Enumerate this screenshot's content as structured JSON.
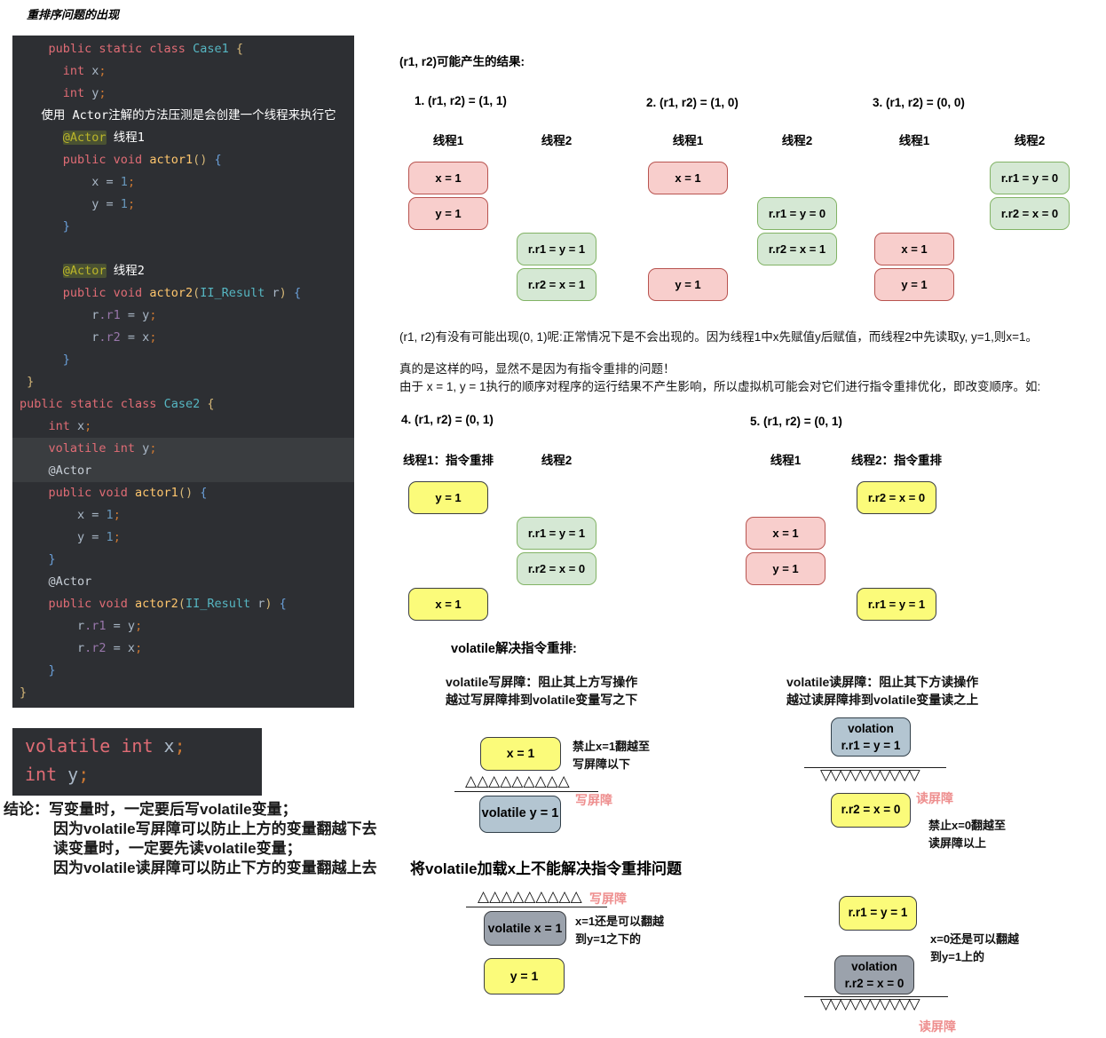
{
  "title": "重排序问题的出现",
  "colors": {
    "code_bg": "#2d2f33",
    "pink_fill": "#f8cecc",
    "pink_border": "#b85450",
    "green_fill": "#d5e8d4",
    "green_border": "#82b366",
    "yellow_fill": "#fbfb7a",
    "dark_border": "#3b3e42",
    "bluegray_fill": "#b3c5d1",
    "gray_fill": "#9ba2ac",
    "barrier_label": "#ee8f8f"
  },
  "code": {
    "main": {
      "lines": [
        {
          "t": [
            [
              "kw",
              "    public static class "
            ],
            [
              "cls",
              "Case1"
            ],
            [
              "by",
              " {"
            ]
          ]
        },
        {
          "t": [
            [
              "kw",
              "      int"
            ],
            [
              "pln",
              " x"
            ],
            [
              "semi",
              ";"
            ]
          ]
        },
        {
          "t": [
            [
              "kw",
              "      int"
            ],
            [
              "pln",
              " y"
            ],
            [
              "semi",
              ";"
            ]
          ]
        },
        {
          "t": [
            [
              "wht",
              "   使用 Actor注解的方法压测是会创建一个线程来执行它"
            ]
          ]
        },
        {
          "t": [
            [
              "pln",
              "      "
            ],
            [
              "ann1",
              "@Actor"
            ],
            [
              "wht",
              " 线程1"
            ]
          ]
        },
        {
          "t": [
            [
              "kw",
              "      public void "
            ],
            [
              "meth",
              "actor1"
            ],
            [
              "by",
              "()"
            ],
            [
              "pln",
              " "
            ],
            [
              "bb",
              "{"
            ]
          ]
        },
        {
          "t": [
            [
              "pln",
              "          x = "
            ],
            [
              "num",
              "1"
            ],
            [
              "semi",
              ";"
            ]
          ]
        },
        {
          "t": [
            [
              "pln",
              "          y = "
            ],
            [
              "num",
              "1"
            ],
            [
              "semi",
              ";"
            ]
          ]
        },
        {
          "t": [
            [
              "bb",
              "      }"
            ]
          ]
        },
        {
          "t": []
        },
        {
          "t": [
            [
              "pln",
              "      "
            ],
            [
              "ann1",
              "@Actor"
            ],
            [
              "wht",
              " 线程2"
            ]
          ]
        },
        {
          "t": [
            [
              "kw",
              "      public void "
            ],
            [
              "meth",
              "actor2"
            ],
            [
              "by",
              "("
            ],
            [
              "cls",
              "II_Result"
            ],
            [
              "pln",
              " r"
            ],
            [
              "by",
              ")"
            ],
            [
              "pln",
              " "
            ],
            [
              "bb",
              "{"
            ]
          ]
        },
        {
          "t": [
            [
              "pln",
              "          r"
            ],
            [
              "fld",
              ".r1"
            ],
            [
              "pln",
              " = y"
            ],
            [
              "semi",
              ";"
            ]
          ]
        },
        {
          "t": [
            [
              "pln",
              "          r"
            ],
            [
              "fld",
              ".r2"
            ],
            [
              "pln",
              " = x"
            ],
            [
              "semi",
              ";"
            ]
          ]
        },
        {
          "t": [
            [
              "bb",
              "      }"
            ]
          ]
        },
        {
          "t": [
            [
              "by",
              " }"
            ]
          ]
        },
        {
          "t": [
            [
              "kw",
              "public static class "
            ],
            [
              "cls",
              "Case2"
            ],
            [
              "by",
              " {"
            ]
          ]
        },
        {
          "t": [
            [
              "kw",
              "    int"
            ],
            [
              "pln",
              " x"
            ],
            [
              "semi",
              ";"
            ]
          ]
        },
        {
          "h": 1,
          "t": [
            [
              "kw",
              "    volatile int"
            ],
            [
              "pln",
              " y"
            ],
            [
              "semi",
              ";"
            ]
          ]
        },
        {
          "h": 1,
          "t": [
            [
              "ann2",
              "    @Actor"
            ]
          ]
        },
        {
          "t": [
            [
              "kw",
              "    public void "
            ],
            [
              "meth",
              "actor1"
            ],
            [
              "by",
              "()"
            ],
            [
              "pln",
              " "
            ],
            [
              "bb",
              "{"
            ]
          ]
        },
        {
          "t": [
            [
              "pln",
              "        x = "
            ],
            [
              "num",
              "1"
            ],
            [
              "semi",
              ";"
            ]
          ]
        },
        {
          "t": [
            [
              "pln",
              "        y = "
            ],
            [
              "num",
              "1"
            ],
            [
              "semi",
              ";"
            ]
          ]
        },
        {
          "t": [
            [
              "bb",
              "    }"
            ]
          ]
        },
        {
          "t": [
            [
              "ann2",
              "    @Actor"
            ]
          ]
        },
        {
          "t": [
            [
              "kw",
              "    public void "
            ],
            [
              "meth",
              "actor2"
            ],
            [
              "by",
              "("
            ],
            [
              "cls",
              "II_Result"
            ],
            [
              "pln",
              " r"
            ],
            [
              "by",
              ")"
            ],
            [
              "pln",
              " "
            ],
            [
              "bb",
              "{"
            ]
          ]
        },
        {
          "t": [
            [
              "pln",
              "        r"
            ],
            [
              "fld",
              ".r1"
            ],
            [
              "pln",
              " = y"
            ],
            [
              "semi",
              ";"
            ]
          ]
        },
        {
          "t": [
            [
              "pln",
              "        r"
            ],
            [
              "fld",
              ".r2"
            ],
            [
              "pln",
              " = x"
            ],
            [
              "semi",
              ";"
            ]
          ]
        },
        {
          "t": [
            [
              "bb",
              "    }"
            ]
          ]
        },
        {
          "t": [
            [
              "by",
              "}"
            ]
          ]
        }
      ]
    },
    "snippet": {
      "lines": [
        {
          "t": [
            [
              "kw",
              "volatile int"
            ],
            [
              "pln",
              " x"
            ],
            [
              "semi",
              ";"
            ]
          ]
        },
        {
          "t": [
            [
              "kw",
              "int"
            ],
            [
              "pln",
              " y"
            ],
            [
              "semi",
              ";"
            ]
          ]
        }
      ]
    }
  },
  "results": {
    "header": "(r1, r2)可能产生的结果:",
    "scenario_headers": [
      "1. (r1, r2) = (1, 1)",
      "2. (r1, r2) = (1, 0)",
      "3. (r1, r2) = (0, 0)",
      "4. (r1, r2) = (0, 1)",
      "5. (r1, r2) = (0, 1)"
    ],
    "scenarios": [
      {
        "col_labels": [
          "线程1",
          "线程2"
        ],
        "boxes": [
          {
            "col": 0,
            "row": 0,
            "color": "pink",
            "label": "x = 1"
          },
          {
            "col": 0,
            "row": 1,
            "color": "pink",
            "label": "y = 1"
          },
          {
            "col": 1,
            "row": 2,
            "color": "green",
            "label": "r.r1 = y = 1"
          },
          {
            "col": 1,
            "row": 3,
            "color": "green",
            "label": "r.r2 = x = 1"
          }
        ]
      },
      {
        "col_labels": [
          "线程1",
          "线程2"
        ],
        "boxes": [
          {
            "col": 0,
            "row": 0,
            "color": "pink",
            "label": "x = 1"
          },
          {
            "col": 1,
            "row": 1,
            "color": "green",
            "label": "r.r1 = y = 0"
          },
          {
            "col": 1,
            "row": 2,
            "color": "green",
            "label": "r.r2 = x = 1"
          },
          {
            "col": 0,
            "row": 3,
            "color": "pink",
            "label": "y = 1"
          }
        ]
      },
      {
        "col_labels": [
          "线程1",
          "线程2"
        ],
        "boxes": [
          {
            "col": 1,
            "row": 0,
            "color": "green",
            "label": "r.r1 = y = 0"
          },
          {
            "col": 1,
            "row": 1,
            "color": "green",
            "label": "r.r2 = x = 0"
          },
          {
            "col": 0,
            "row": 2,
            "color": "pink",
            "label": "x = 1"
          },
          {
            "col": 0,
            "row": 3,
            "color": "pink",
            "label": "y = 1"
          }
        ]
      },
      {
        "col_labels": [
          "线程1：指令重排",
          "线程2"
        ],
        "boxes": [
          {
            "col": 0,
            "row": 0,
            "color": "yellow",
            "label": "y = 1"
          },
          {
            "col": 1,
            "row": 1,
            "color": "green",
            "label": "r.r1 = y = 1"
          },
          {
            "col": 1,
            "row": 2,
            "color": "green",
            "label": "r.r2 = x = 0"
          },
          {
            "col": 0,
            "row": 3,
            "color": "yellow",
            "label": "x = 1"
          }
        ]
      },
      {
        "col_labels": [
          "线程1",
          "线程2：指令重排"
        ],
        "boxes": [
          {
            "col": 1,
            "row": 0,
            "color": "yellow",
            "label": "r.r2 = x = 0"
          },
          {
            "col": 0,
            "row": 1,
            "color": "pink",
            "label": "x = 1"
          },
          {
            "col": 0,
            "row": 2,
            "color": "pink",
            "label": "y = 1"
          },
          {
            "col": 1,
            "row": 3,
            "color": "yellow",
            "label": "r.r1 = y = 1"
          }
        ]
      }
    ]
  },
  "analysis": {
    "l1": "(r1, r2)有没有可能出现(0, 1)呢:正常情况下是不会出现的。因为线程1中x先赋值y后赋值，而线程2中先读取y, y=1,则x=1。",
    "l2": "真的是这样的吗，显然不是因为有指令重排的问题！",
    "l3": "由于 x = 1, y = 1执行的顺序对程序的运行结果不产生影响，所以虚拟机可能会对它们进行指令重排优化，即改变顺序。如:"
  },
  "volatile_section": {
    "title": "volatile解决指令重排:",
    "write_desc1": "volatile写屏障：阻止其上方写操作",
    "write_desc2": "越过写屏障排到volatile变量写之下",
    "read_desc1": "volatile读屏障：阻止其下方读操作",
    "read_desc2": "越过读屏障排到volatile变量读之上",
    "up_glyphs": "△△△△△△△△△",
    "down_glyphs": "▽▽▽▽▽▽▽▽▽▽",
    "write_label": "写屏障",
    "read_label": "读屏障",
    "wb_box_top": "x = 1",
    "wb_box_bottom": "volatile y = 1",
    "wb_note1": "禁止x=1翻越至",
    "wb_note2": "写屏障以下",
    "rb_box_top1": "volation",
    "rb_box_top2": "r.r1 = y = 1",
    "rb_box_bottom": "r.r2 = x = 0",
    "rb_note1": "禁止x=0翻越至",
    "rb_note2": "读屏障以上"
  },
  "conclusion": {
    "l1": "结论：写变量时，一定要后写volatile变量；",
    "l2": "因为volatile写屏障可以防止上方的变量翻越下去",
    "l3": "读变量时，一定要先读volatile变量；",
    "l4": "因为volatile读屏障可以防止下方的变量翻越上去"
  },
  "bottom": {
    "title": "将volatile加载x上不能解决指令重排问题",
    "write_label": "写屏障",
    "read_label": "读屏障",
    "up_glyphs": "△△△△△△△△△",
    "down_glyphs": "▽▽▽▽▽▽▽▽▽▽",
    "wb_box_top": "volatile  x = 1",
    "wb_box_bottom": "y = 1",
    "wb_note1": "x=1还是可以翻越",
    "wb_note2": "到y=1之下的",
    "rb_box_top": "r.r1 = y = 1",
    "rb_box_mid1": "volation",
    "rb_box_mid2": "r.r2 = x = 0",
    "rb_note1": "x=0还是可以翻越",
    "rb_note2": "到y=1上的"
  }
}
